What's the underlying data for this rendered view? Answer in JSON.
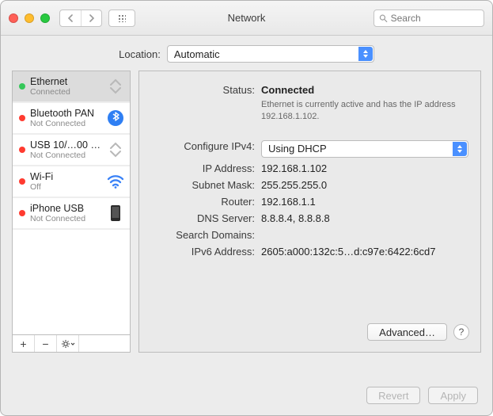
{
  "window": {
    "title": "Network"
  },
  "search": {
    "placeholder": "Search"
  },
  "location": {
    "label": "Location:",
    "value": "Automatic"
  },
  "sidebar": {
    "items": [
      {
        "name": "Ethernet",
        "sub": "Connected",
        "status": "green",
        "icon": "ethernet"
      },
      {
        "name": "Bluetooth PAN",
        "sub": "Not Connected",
        "status": "red",
        "icon": "bluetooth"
      },
      {
        "name": "USB 10/…00 LAN",
        "sub": "Not Connected",
        "status": "red",
        "icon": "ethernet"
      },
      {
        "name": "Wi-Fi",
        "sub": "Off",
        "status": "red",
        "icon": "wifi"
      },
      {
        "name": "iPhone USB",
        "sub": "Not Connected",
        "status": "red",
        "icon": "phone"
      }
    ],
    "actions": {
      "add": "+",
      "remove": "−"
    }
  },
  "details": {
    "status_label": "Status:",
    "status_value": "Connected",
    "status_note": "Ethernet is currently active and has the IP address 192.168.1.102.",
    "configure_label": "Configure IPv4:",
    "configure_value": "Using DHCP",
    "ip_label": "IP Address:",
    "ip_value": "192.168.1.102",
    "subnet_label": "Subnet Mask:",
    "subnet_value": "255.255.255.0",
    "router_label": "Router:",
    "router_value": "192.168.1.1",
    "dns_label": "DNS Server:",
    "dns_value": "8.8.8.4, 8.8.8.8",
    "search_label": "Search Domains:",
    "search_value": "",
    "ipv6_label": "IPv6 Address:",
    "ipv6_value": "2605:a000:132c:5…d:c97e:6422:6cd7",
    "advanced": "Advanced…"
  },
  "footer": {
    "revert": "Revert",
    "apply": "Apply"
  }
}
